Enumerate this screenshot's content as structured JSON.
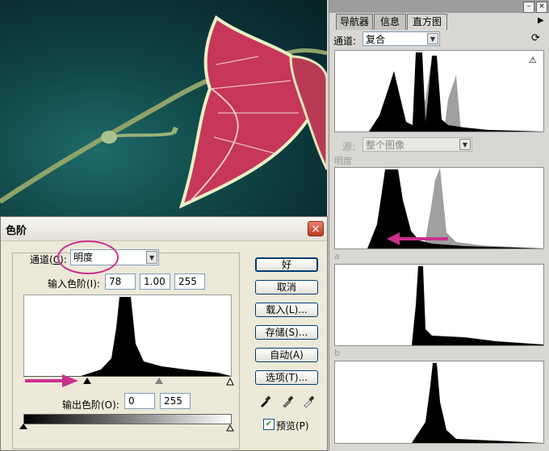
{
  "palette": {
    "tabs": [
      {
        "label": "导航器",
        "active": false
      },
      {
        "label": "信息",
        "active": false
      },
      {
        "label": "直方图",
        "active": true
      }
    ],
    "channel_label": "通道:",
    "channel_value": "复合",
    "source_label": "源:",
    "source_value": "整个图像",
    "section_brightness": "明度",
    "section_a": "a",
    "section_b": "b",
    "icons": {
      "refresh": "refresh-icon",
      "warning": "warning-icon",
      "menu": "palette-menu-icon"
    }
  },
  "dialog": {
    "title": "色阶",
    "close_glyph": "×",
    "channel_label": "通道(",
    "channel_key": "C",
    "channel_suffix": "):",
    "channel_value": "明度",
    "input_levels_label": "输入色阶(I):",
    "input_black": "78",
    "input_gamma": "1.00",
    "input_white": "255",
    "output_levels_label": "输出色阶(O):",
    "output_black": "0",
    "output_white": "255",
    "buttons": [
      "好",
      "取消",
      "载入(L)...",
      "存储(S)...",
      "自动(A)",
      "选项(T)..."
    ],
    "preview_label": "预览(P)",
    "preview_checked": true
  },
  "colors": {
    "annotation": "#cc2f8e",
    "close_button": "#c1381e"
  }
}
